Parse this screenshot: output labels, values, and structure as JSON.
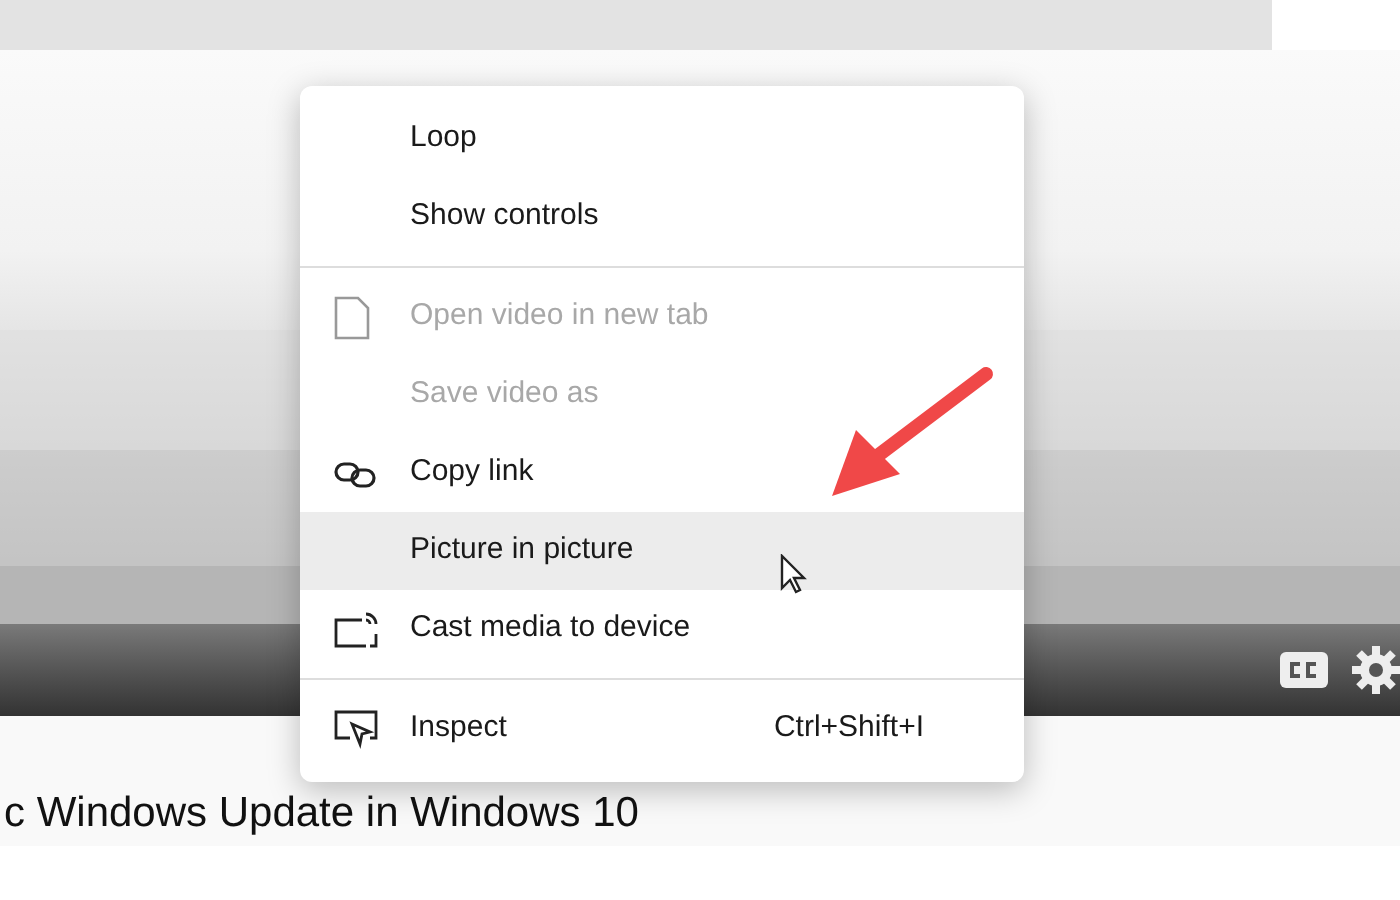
{
  "menu": {
    "sections": [
      {
        "items": [
          {
            "label": "Loop",
            "disabled": false,
            "selected": false
          },
          {
            "label": "Show controls",
            "disabled": false,
            "selected": false
          }
        ]
      },
      {
        "items": [
          {
            "label": "Open video in new tab",
            "disabled": true,
            "selected": false
          },
          {
            "label": "Save video as",
            "disabled": true,
            "selected": false
          },
          {
            "label": "Copy link",
            "disabled": false,
            "selected": false
          },
          {
            "label": "Picture in picture",
            "disabled": false,
            "selected": true
          },
          {
            "label": "Cast media to device",
            "disabled": false,
            "selected": false
          }
        ]
      },
      {
        "items": [
          {
            "label": "Inspect",
            "disabled": false,
            "selected": false,
            "shortcut": "Ctrl+Shift+I"
          }
        ]
      }
    ]
  },
  "page_title": "c Windows Update in Windows 10"
}
